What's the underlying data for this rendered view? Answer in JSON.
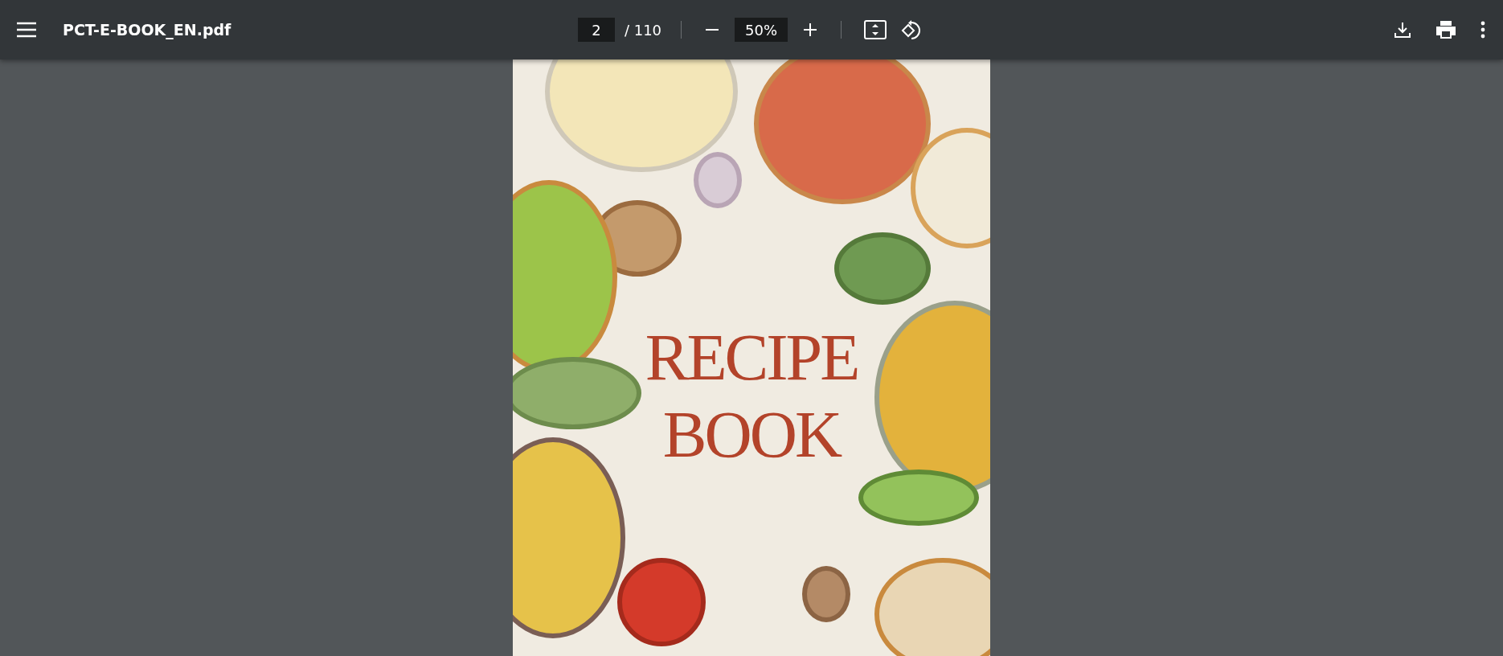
{
  "toolbar": {
    "file_name": "PCT-E-BOOK_EN.pdf",
    "page_number": "2",
    "page_total": "/ 110",
    "zoom": "50%"
  },
  "page": {
    "title_lines": [
      "RECIPE",
      "BOOK"
    ]
  }
}
